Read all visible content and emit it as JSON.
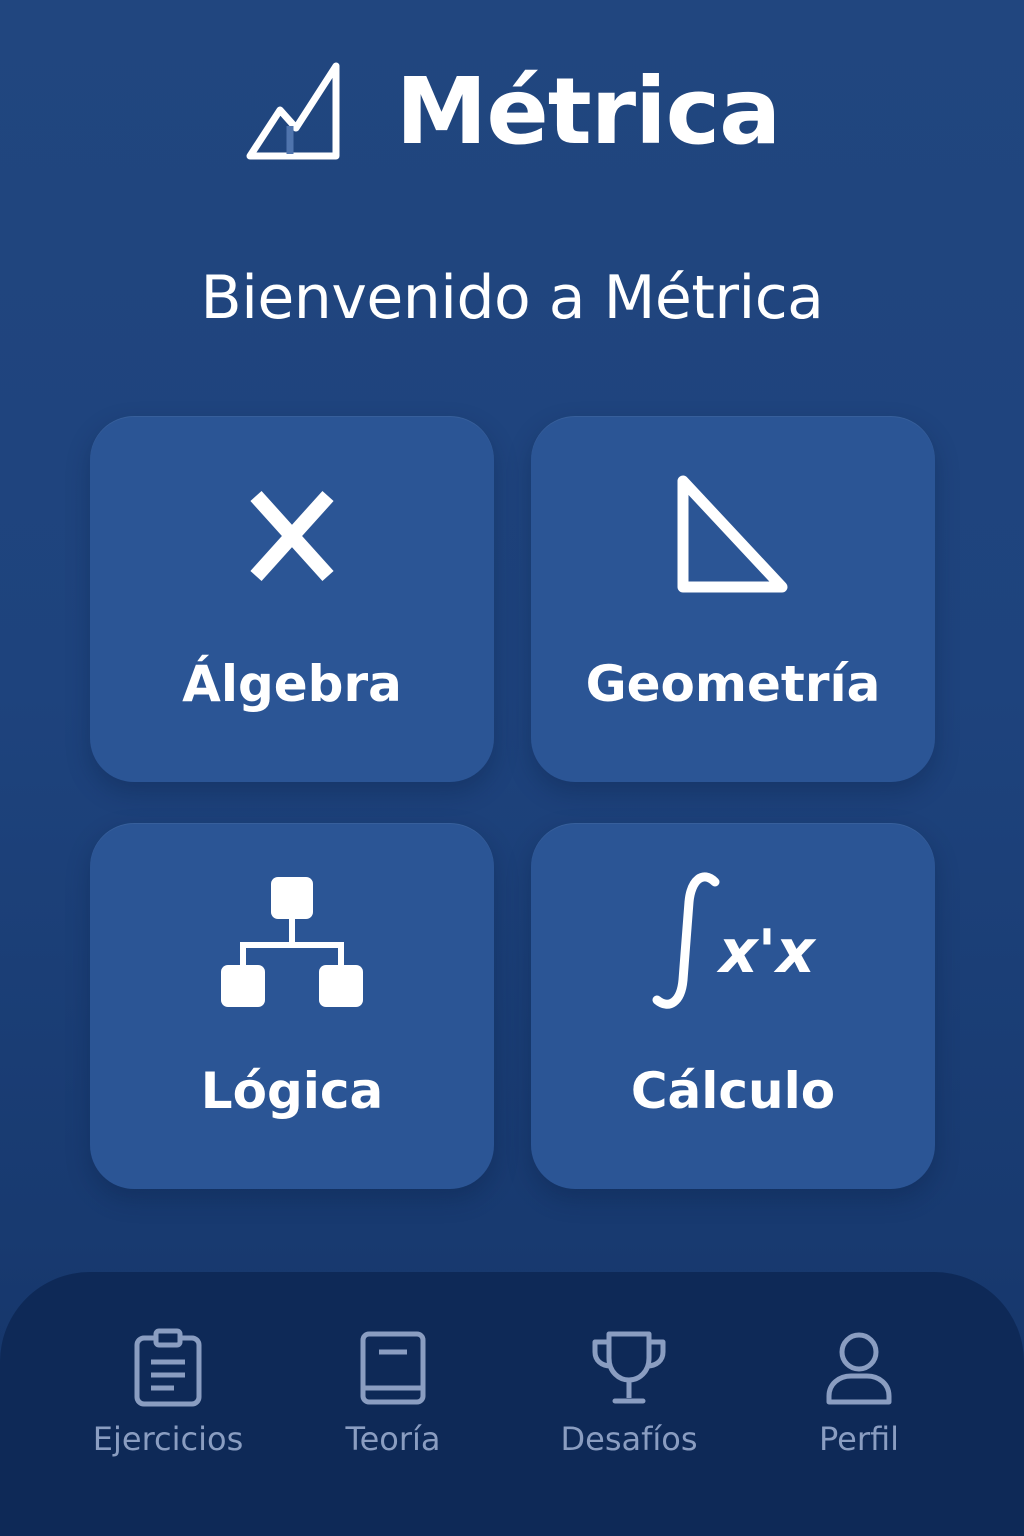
{
  "app": {
    "title": "Métrica",
    "logo_icon": "chart-line-icon"
  },
  "welcome": {
    "text": "Bienvenido a Métrica"
  },
  "topics": [
    {
      "label": "Álgebra",
      "icon": "variable-x-icon"
    },
    {
      "label": "Geometría",
      "icon": "triangle-icon"
    },
    {
      "label": "Lógica",
      "icon": "flowchart-icon"
    },
    {
      "label": "Cálculo",
      "icon": "integral-icon",
      "icon_text": "x'x"
    }
  ],
  "nav": {
    "items": [
      {
        "label": "Ejercicios",
        "icon": "clipboard-icon"
      },
      {
        "label": "Teoría",
        "icon": "book-icon"
      },
      {
        "label": "Desafíos",
        "icon": "trophy-icon"
      },
      {
        "label": "Perfil",
        "icon": "user-icon"
      }
    ]
  },
  "colors": {
    "background": "#1e437d",
    "card": "#2b5595",
    "nav_background": "#0e2957",
    "nav_inactive": "#8a9dc1",
    "text": "#ffffff"
  }
}
